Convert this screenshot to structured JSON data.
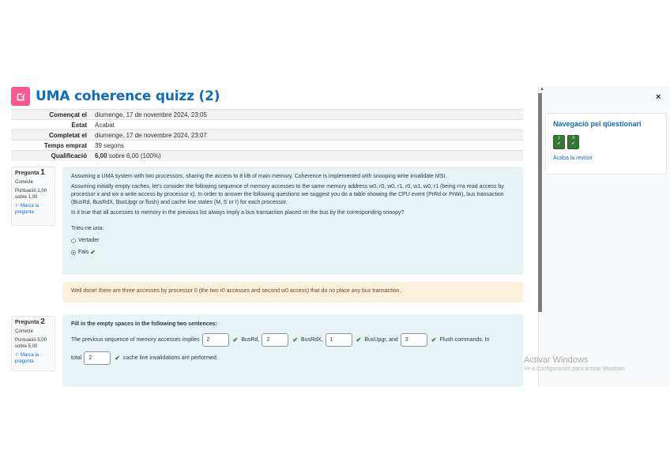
{
  "quiz": {
    "title": "UMA coherence quizz (2)"
  },
  "summary": [
    {
      "label": "Començat el",
      "value": "diumenge, 17 de novembre 2024, 23:05"
    },
    {
      "label": "Estat",
      "value": "Acabat"
    },
    {
      "label": "Completat el",
      "value": "diumenge, 17 de novembre 2024, 23:07"
    },
    {
      "label": "Temps emprat",
      "value": "39 segons"
    },
    {
      "label": "Qualificació",
      "value_bold": "6,00",
      "value_rest": "sobre 6,00 (100%)"
    }
  ],
  "q1": {
    "label": "Pregunta",
    "number": "1",
    "state": "Correcte",
    "grade": "Puntuació 1,00 sobre 1,00",
    "flag": "Marca la pregunta",
    "text1": "Assuming a UMA system with two processors, sharing the access to 8 kB of main memory. Coherence is implemented with snooping write invalidate MSI.",
    "text2": "Assuming initially empty caches, let's consider the following sequence of memory accesses to the same memory address w0, r0, w0, r1, r0, w1, w0, r1 (being r=a read access by processor x and wx a write access by processor x). In order to answer the following questions we suggest you do a table showing the CPU event (PrRd or PrWr), bus transaction (BusRd, BusRdX, BusUpgr or flush) and cache line states (M, S or I) for each processor.",
    "text3": "Is it true that all accesses to memory in the previous list always imply a bus transaction placed on the bus by the corresponding snoopy?",
    "prompt": "Trieu-ne una:",
    "options": [
      "Vertader",
      "Fals"
    ],
    "feedback": "Well done! there are three accesses by processor 0 (the two r0 accesses and second w0 access) that do no place any bus transaction."
  },
  "q2": {
    "label": "Pregunta",
    "number": "2",
    "state": "Correcte",
    "grade": "Puntuació 5,00 sobre 5,00",
    "flag": "Marca la pregunta",
    "heading": "Fill in the empty spaces in the following two sentences:",
    "s1": "The previous sequence of memory accesses implies",
    "v1": "2",
    "s2": "BusRd,",
    "v2": "2",
    "s3": "BusRdX,",
    "v3": "1",
    "s4": "BusUpgr, and",
    "v4": "3",
    "s5": "Flush commands. In",
    "s6": "total",
    "v5": "2",
    "s7": "cache line invalidations are performed."
  },
  "drawer": {
    "close": "×",
    "nav_title": "Navegació pel qüestionari",
    "buttons": [
      "1",
      "2"
    ],
    "finish_review": "Acaba la revisió"
  },
  "watermark": {
    "line1": "Activar Windows",
    "line2": "Ve a Configuración para activar Windows."
  }
}
